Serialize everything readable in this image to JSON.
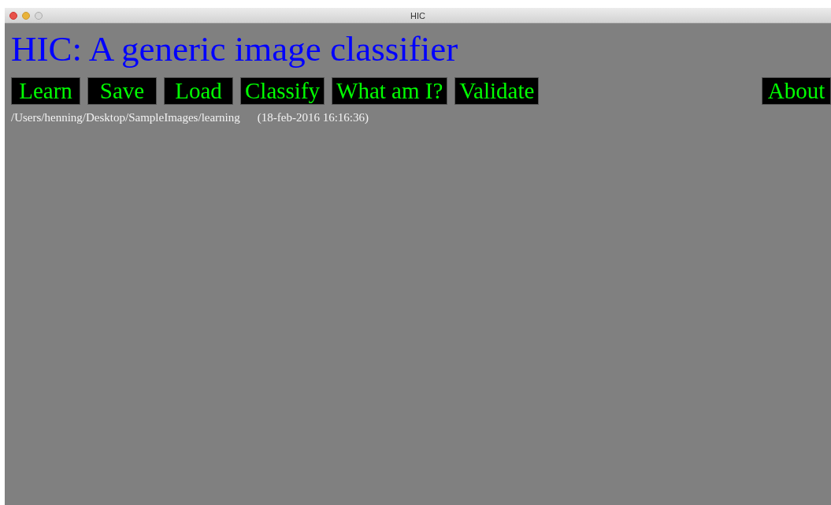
{
  "window": {
    "title": "HIC"
  },
  "heading": "HIC: A generic image classifier",
  "buttons": [
    "Learn",
    "Save",
    "Load",
    "Classify",
    "What am I?",
    "Validate"
  ],
  "about_button": "About",
  "status": {
    "path": "/Users/henning/Desktop/SampleImages/learning",
    "timestamp": "(18-feb-2016 16:16:36)"
  }
}
